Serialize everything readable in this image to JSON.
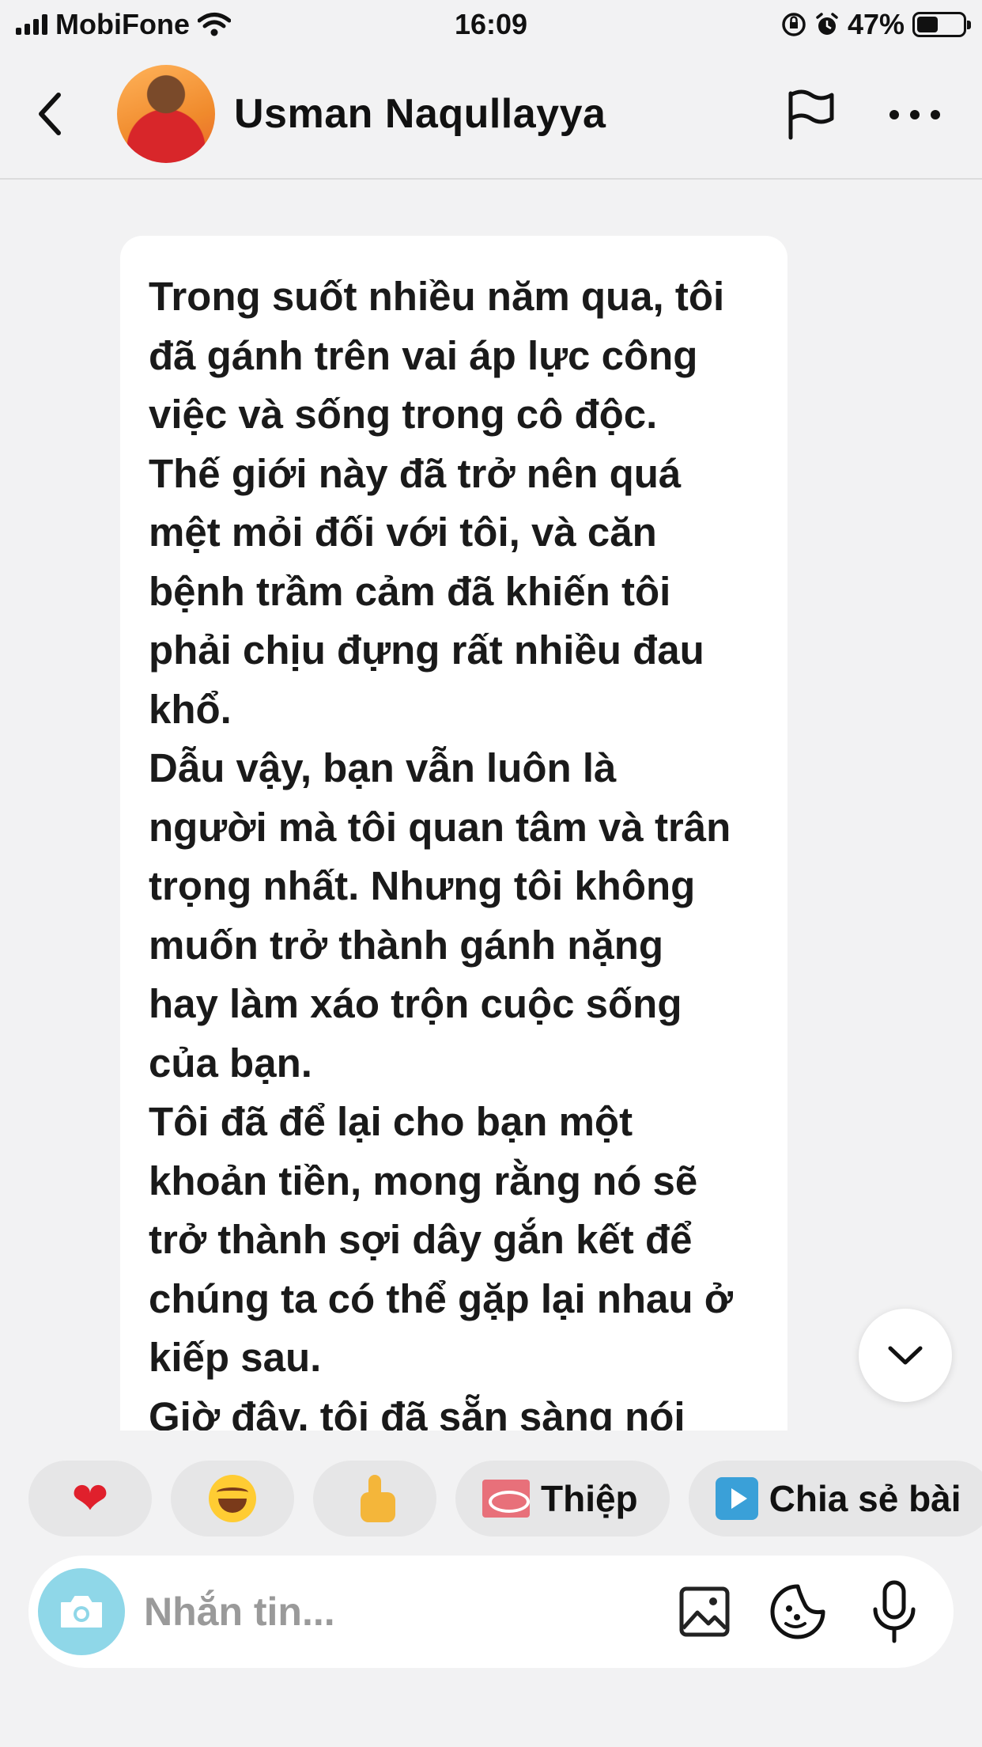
{
  "status_bar": {
    "carrier": "MobiFone",
    "time": "16:09",
    "battery": "47%",
    "battery_level": 0.47
  },
  "header": {
    "contact_name": "Usman Naqullayya"
  },
  "message": {
    "text": "Trong suốt nhiều năm qua, tôi\nđã gánh trên vai áp lực công\nviệc và sống trong cô độc.\nThế giới này đã trở nên quá\nmệt mỏi đối với tôi, và căn\nbệnh trầm cảm đã khiến tôi\nphải chịu đựng rất nhiều đau\nkhổ.\nDẫu vậy, bạn vẫn luôn là\nngười mà tôi quan tâm và trân\ntrọng nhất. Nhưng tôi không\nmuốn trở thành gánh nặng\nhay làm xáo trộn cuộc sống\ncủa bạn.\nTôi đã để lại cho bạn một\nkhoản tiền, mong rằng nó sẽ\ntrở thành sợi dây gắn kết để\nchúng ta có thể gặp lại nhau ở\nkiếp sau.\nGiờ đây, tôi đã sẵn sàng nói"
  },
  "quick_replies": {
    "heart": "❤",
    "card_label": "Thiệp",
    "share_label": "Chia sẻ bài"
  },
  "composer": {
    "placeholder": "Nhắn tin..."
  },
  "colors": {
    "background": "#f2f2f3",
    "bubble": "#ffffff",
    "camera_button": "#8fd7e8",
    "heart": "#e0202c"
  },
  "icons": [
    "back-icon",
    "flag-icon",
    "more-icon",
    "chevron-down-icon",
    "camera-icon",
    "gallery-icon",
    "sticker-icon",
    "mic-icon",
    "wifi-icon",
    "alarm-icon",
    "rotation-lock-icon",
    "battery-icon"
  ]
}
